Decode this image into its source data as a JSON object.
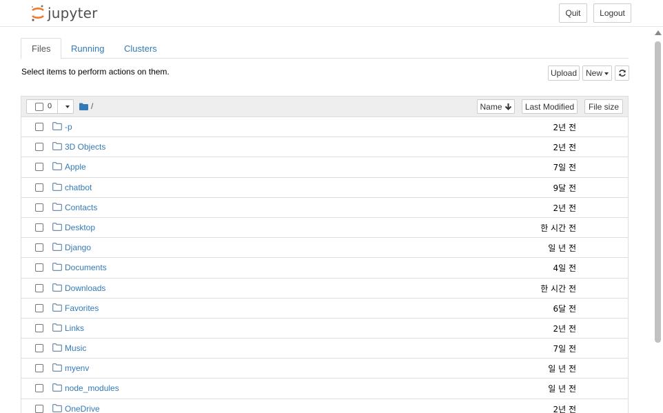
{
  "header": {
    "logo_text": "jupyter",
    "quit_label": "Quit",
    "logout_label": "Logout"
  },
  "tabs": [
    {
      "label": "Files",
      "active": true
    },
    {
      "label": "Running",
      "active": false
    },
    {
      "label": "Clusters",
      "active": false
    }
  ],
  "toolbar": {
    "hint": "Select items to perform actions on them.",
    "upload_label": "Upload",
    "new_label": "New",
    "refresh_icon": "refresh-icon"
  },
  "list_header": {
    "selected_count": "0",
    "breadcrumb_root": "/",
    "sort_name_label": "Name",
    "sort_modified_label": "Last Modified",
    "sort_size_label": "File size"
  },
  "files": [
    {
      "name": "-p",
      "modified": "2년 전"
    },
    {
      "name": "3D Objects",
      "modified": "2년 전"
    },
    {
      "name": "Apple",
      "modified": "7일 전"
    },
    {
      "name": "chatbot",
      "modified": "9달 전"
    },
    {
      "name": "Contacts",
      "modified": "2년 전"
    },
    {
      "name": "Desktop",
      "modified": "한 시간 전"
    },
    {
      "name": "Django",
      "modified": "일 년 전"
    },
    {
      "name": "Documents",
      "modified": "4일 전"
    },
    {
      "name": "Downloads",
      "modified": "한 시간 전"
    },
    {
      "name": "Favorites",
      "modified": "6달 전"
    },
    {
      "name": "Links",
      "modified": "2년 전"
    },
    {
      "name": "Music",
      "modified": "7일 전"
    },
    {
      "name": "myenv",
      "modified": "일 년 전"
    },
    {
      "name": "node_modules",
      "modified": "일 년 전"
    },
    {
      "name": "OneDrive",
      "modified": "2년 전"
    }
  ],
  "colors": {
    "link": "#337ab7",
    "logo_orange": "#f37726",
    "folder_icon": "#5f7f9f"
  }
}
